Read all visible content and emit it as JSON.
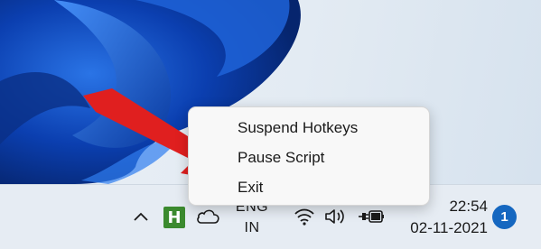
{
  "context_menu": {
    "items": [
      {
        "label": "Suspend Hotkeys"
      },
      {
        "label": "Pause Script"
      },
      {
        "label": "Exit"
      }
    ]
  },
  "taskbar": {
    "tray_icons": {
      "overflow": "chevron-up-icon",
      "autohotkey": {
        "icon": "autohotkey-icon",
        "glyph": "H",
        "color": "#3b8a2e"
      },
      "onedrive": "cloud-icon",
      "network": "wifi-icon",
      "volume": "speaker-icon",
      "power": "battery-charging-icon"
    },
    "language": {
      "line1": "ENG",
      "line2": "IN"
    },
    "clock": {
      "time": "22:54",
      "date": "02-11-2021"
    },
    "notifications": {
      "count": "1",
      "color": "#1567c0"
    }
  },
  "annotation": {
    "arrow_color": "#e01f1f"
  },
  "wallpaper": {
    "accent": "#0a3fa8"
  }
}
